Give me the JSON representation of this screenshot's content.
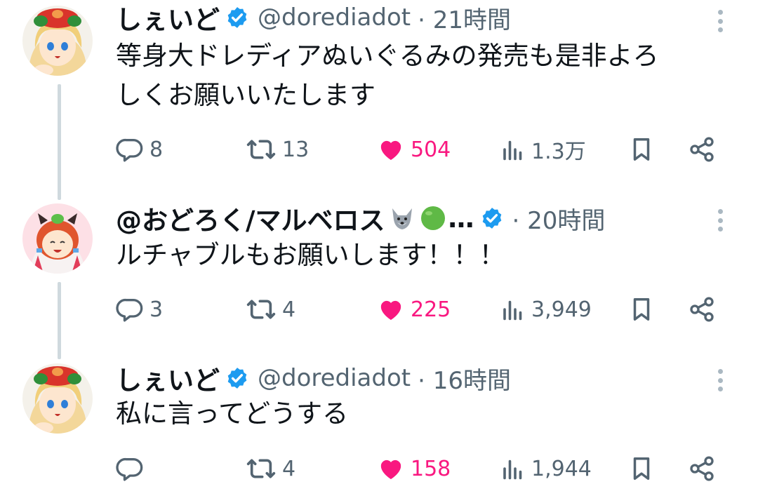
{
  "tweets": [
    {
      "author": "しぇいど",
      "handle": "@dorediadot",
      "time": "· 21時間",
      "text_lines": [
        "等身大ドレディアぬいぐるみの発売も是非よろ",
        "しくお願いいたします"
      ],
      "replies": "8",
      "retweets": "13",
      "likes": "504",
      "views": "1.3万"
    },
    {
      "author": "@おどろく/マルベロス",
      "author_emojis": [
        "wolf-emoji",
        "green-circle-emoji"
      ],
      "author_ellipsis": "…",
      "time": "· 20時間",
      "text_lines": [
        "ルチャブルもお願いします！！！"
      ],
      "replies": "3",
      "retweets": "4",
      "likes": "225",
      "views": "3,949"
    },
    {
      "author": "しぇいど",
      "handle": "@dorediadot",
      "time": "· 16時間",
      "text_lines": [
        "私に言ってどうする"
      ],
      "replies": "",
      "retweets": "4",
      "likes": "158",
      "views": "1,944"
    }
  ],
  "icons": {
    "verified": "verified-badge-icon",
    "reply": "reply-icon",
    "retweet": "retweet-icon",
    "like": "heart-icon",
    "views": "views-icon",
    "bookmark": "bookmark-icon",
    "share": "share-icon",
    "more": "more-vertical-icon"
  },
  "colors": {
    "text": "#0f1419",
    "meta": "#536471",
    "like": "#f91880",
    "verified": "#1d9bf0",
    "thread_line": "#cfd9de"
  }
}
